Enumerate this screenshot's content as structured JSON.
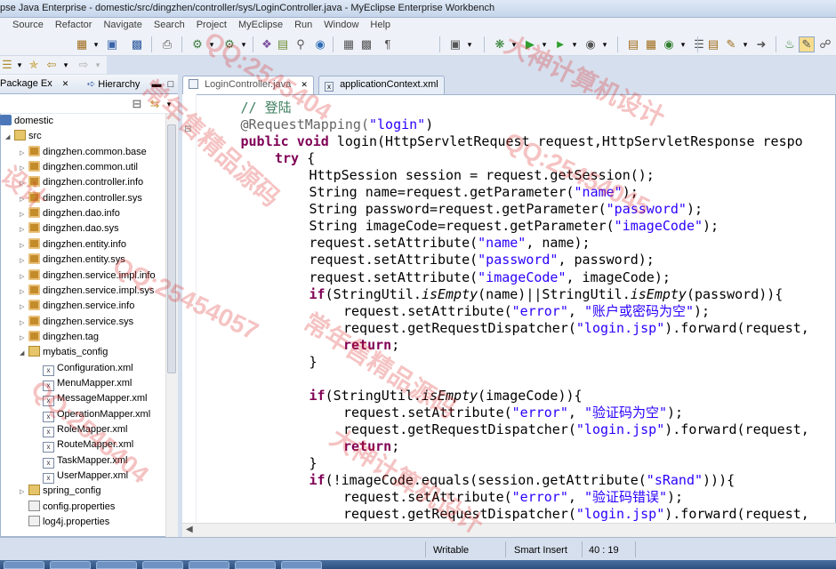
{
  "window": {
    "title": "pse Java Enterprise - domestic/src/dingzhen/controller/sys/LoginController.java - MyEclipse Enterprise Workbench"
  },
  "menu": [
    "Source",
    "Refactor",
    "Navigate",
    "Search",
    "Project",
    "MyEclipse",
    "Run",
    "Window",
    "Help"
  ],
  "left_panel": {
    "tabs": [
      {
        "label": "Package Ex",
        "close": "✕"
      },
      {
        "label": "Hierarchy"
      }
    ],
    "tree": [
      {
        "label": "domestic",
        "type": "project",
        "indent": 0,
        "toggle": "◢"
      },
      {
        "label": "src",
        "type": "folder",
        "indent": 1,
        "toggle": "◢"
      },
      {
        "label": "dingzhen.common.base",
        "type": "package",
        "indent": 2,
        "toggle": "▷"
      },
      {
        "label": "dingzhen.common.util",
        "type": "package",
        "indent": 2,
        "toggle": "▷"
      },
      {
        "label": "dingzhen.controller.info",
        "type": "package",
        "indent": 2,
        "toggle": "▷"
      },
      {
        "label": "dingzhen.controller.sys",
        "type": "package",
        "indent": 2,
        "toggle": "▷"
      },
      {
        "label": "dingzhen.dao.info",
        "type": "package",
        "indent": 2,
        "toggle": "▷"
      },
      {
        "label": "dingzhen.dao.sys",
        "type": "package",
        "indent": 2,
        "toggle": "▷"
      },
      {
        "label": "dingzhen.entity.info",
        "type": "package",
        "indent": 2,
        "toggle": "▷"
      },
      {
        "label": "dingzhen.entity.sys",
        "type": "package",
        "indent": 2,
        "toggle": "▷"
      },
      {
        "label": "dingzhen.service.impl.info",
        "type": "package",
        "indent": 2,
        "toggle": "▷"
      },
      {
        "label": "dingzhen.service.impl.sys",
        "type": "package",
        "indent": 2,
        "toggle": "▷"
      },
      {
        "label": "dingzhen.service.info",
        "type": "package",
        "indent": 2,
        "toggle": "▷"
      },
      {
        "label": "dingzhen.service.sys",
        "type": "package",
        "indent": 2,
        "toggle": "▷"
      },
      {
        "label": "dingzhen.tag",
        "type": "package",
        "indent": 2,
        "toggle": "▷"
      },
      {
        "label": "mybatis_config",
        "type": "folder",
        "indent": 2,
        "toggle": "◢"
      },
      {
        "label": "Configuration.xml",
        "type": "xml",
        "indent": 3,
        "toggle": ""
      },
      {
        "label": "MenuMapper.xml",
        "type": "xml",
        "indent": 3,
        "toggle": ""
      },
      {
        "label": "MessageMapper.xml",
        "type": "xml",
        "indent": 3,
        "toggle": ""
      },
      {
        "label": "OperationMapper.xml",
        "type": "xml",
        "indent": 3,
        "toggle": ""
      },
      {
        "label": "RoleMapper.xml",
        "type": "xml",
        "indent": 3,
        "toggle": ""
      },
      {
        "label": "RouteMapper.xml",
        "type": "xml",
        "indent": 3,
        "toggle": ""
      },
      {
        "label": "TaskMapper.xml",
        "type": "xml",
        "indent": 3,
        "toggle": ""
      },
      {
        "label": "UserMapper.xml",
        "type": "xml",
        "indent": 3,
        "toggle": ""
      },
      {
        "label": "spring_config",
        "type": "folder",
        "indent": 2,
        "toggle": "▷"
      },
      {
        "label": "config.properties",
        "type": "prop",
        "indent": 2,
        "toggle": ""
      },
      {
        "label": "log4j.properties",
        "type": "prop",
        "indent": 2,
        "toggle": ""
      }
    ]
  },
  "editor": {
    "tabs": [
      {
        "label": "LoginController.java",
        "close": "✕",
        "active": true,
        "icon": "java-file-icon"
      },
      {
        "label": "applicationContext.xml",
        "active": false,
        "icon": "xml-file-icon"
      }
    ],
    "lines": [
      {
        "indent": 1,
        "parts": [
          {
            "c": "cmt",
            "t": "// 登陆"
          }
        ]
      },
      {
        "indent": 1,
        "parts": [
          {
            "c": "ann",
            "t": "@RequestMapping("
          },
          {
            "c": "str",
            "t": "\"login\""
          },
          {
            "c": "",
            "t": ")"
          }
        ]
      },
      {
        "indent": 1,
        "parts": [
          {
            "c": "kw",
            "t": "public void "
          },
          {
            "c": "",
            "t": "login(HttpServletRequest request,HttpServletResponse respo"
          }
        ]
      },
      {
        "indent": 2,
        "parts": [
          {
            "c": "kw",
            "t": "try"
          },
          {
            "c": "",
            "t": " {"
          }
        ]
      },
      {
        "indent": 3,
        "parts": [
          {
            "c": "",
            "t": "HttpSession session = request.getSession();"
          }
        ]
      },
      {
        "indent": 3,
        "parts": [
          {
            "c": "",
            "t": "String name=request.getParameter("
          },
          {
            "c": "str",
            "t": "\"name\""
          },
          {
            "c": "",
            "t": ");"
          }
        ]
      },
      {
        "indent": 3,
        "parts": [
          {
            "c": "",
            "t": "String password=request.getParameter("
          },
          {
            "c": "str",
            "t": "\"password\""
          },
          {
            "c": "",
            "t": ");"
          }
        ]
      },
      {
        "indent": 3,
        "parts": [
          {
            "c": "",
            "t": "String imageCode=request.getParameter("
          },
          {
            "c": "str",
            "t": "\"imageCode\""
          },
          {
            "c": "",
            "t": ");"
          }
        ]
      },
      {
        "indent": 3,
        "parts": [
          {
            "c": "",
            "t": "request.setAttribute("
          },
          {
            "c": "str",
            "t": "\"name\""
          },
          {
            "c": "",
            "t": ", name);"
          }
        ]
      },
      {
        "indent": 3,
        "parts": [
          {
            "c": "",
            "t": "request.setAttribute("
          },
          {
            "c": "str",
            "t": "\"password\""
          },
          {
            "c": "",
            "t": ", password);"
          }
        ]
      },
      {
        "indent": 3,
        "parts": [
          {
            "c": "",
            "t": "request.setAttribute("
          },
          {
            "c": "str",
            "t": "\"imageCode\""
          },
          {
            "c": "",
            "t": ", imageCode);"
          }
        ]
      },
      {
        "indent": 3,
        "parts": [
          {
            "c": "kw",
            "t": "if"
          },
          {
            "c": "",
            "t": "(StringUtil."
          },
          {
            "c": "it",
            "t": "isEmpty"
          },
          {
            "c": "",
            "t": "(name)||StringUtil."
          },
          {
            "c": "it",
            "t": "isEmpty"
          },
          {
            "c": "",
            "t": "(password)){"
          }
        ]
      },
      {
        "indent": 4,
        "parts": [
          {
            "c": "",
            "t": "request.setAttribute("
          },
          {
            "c": "str",
            "t": "\"error\""
          },
          {
            "c": "",
            "t": ", "
          },
          {
            "c": "str",
            "t": "\"账户或密码为空\""
          },
          {
            "c": "",
            "t": ");"
          }
        ]
      },
      {
        "indent": 4,
        "parts": [
          {
            "c": "",
            "t": "request.getRequestDispatcher("
          },
          {
            "c": "str",
            "t": "\"login.jsp\""
          },
          {
            "c": "",
            "t": ").forward(request,"
          }
        ]
      },
      {
        "indent": 4,
        "parts": [
          {
            "c": "kw",
            "t": "return"
          },
          {
            "c": "",
            "t": ";"
          }
        ]
      },
      {
        "indent": 3,
        "parts": [
          {
            "c": "",
            "t": "}"
          }
        ]
      },
      {
        "indent": 0,
        "parts": [
          {
            "c": "",
            "t": ""
          }
        ]
      },
      {
        "indent": 3,
        "parts": [
          {
            "c": "kw",
            "t": "if"
          },
          {
            "c": "",
            "t": "(StringUtil."
          },
          {
            "c": "it",
            "t": "isEmpty"
          },
          {
            "c": "",
            "t": "(imageCode)){"
          }
        ]
      },
      {
        "indent": 4,
        "parts": [
          {
            "c": "",
            "t": "request.setAttribute("
          },
          {
            "c": "str",
            "t": "\"error\""
          },
          {
            "c": "",
            "t": ", "
          },
          {
            "c": "str",
            "t": "\"验证码为空\""
          },
          {
            "c": "",
            "t": ");"
          }
        ]
      },
      {
        "indent": 4,
        "parts": [
          {
            "c": "",
            "t": "request.getRequestDispatcher("
          },
          {
            "c": "str",
            "t": "\"login.jsp\""
          },
          {
            "c": "",
            "t": ").forward(request,"
          }
        ]
      },
      {
        "indent": 4,
        "parts": [
          {
            "c": "kw",
            "t": "return"
          },
          {
            "c": "",
            "t": ";"
          }
        ]
      },
      {
        "indent": 3,
        "parts": [
          {
            "c": "",
            "t": "}"
          }
        ]
      },
      {
        "indent": 3,
        "parts": [
          {
            "c": "kw",
            "t": "if"
          },
          {
            "c": "",
            "t": "(!imageCode.equals(session.getAttribute("
          },
          {
            "c": "str",
            "t": "\"sRand\""
          },
          {
            "c": "",
            "t": "))){"
          }
        ]
      },
      {
        "indent": 4,
        "parts": [
          {
            "c": "",
            "t": "request.setAttribute("
          },
          {
            "c": "str",
            "t": "\"error\""
          },
          {
            "c": "",
            "t": ", "
          },
          {
            "c": "str",
            "t": "\"验证码错误\""
          },
          {
            "c": "",
            "t": ");"
          }
        ]
      },
      {
        "indent": 4,
        "parts": [
          {
            "c": "",
            "t": "request.getRequestDispatcher("
          },
          {
            "c": "str",
            "t": "\"login.jsp\""
          },
          {
            "c": "",
            "t": ").forward(request,"
          }
        ]
      }
    ]
  },
  "status": {
    "writable": "Writable",
    "insert_mode": "Smart Insert",
    "position": "40 : 19"
  },
  "watermarks": [
    "QQ:2545404",
    "大神计算机设计",
    "常年售精品源码",
    "QQ:25454045",
    "设计",
    "QQ:25454057",
    "常年售精品源码",
    "QQ:2545404",
    "大神计算机设计"
  ]
}
